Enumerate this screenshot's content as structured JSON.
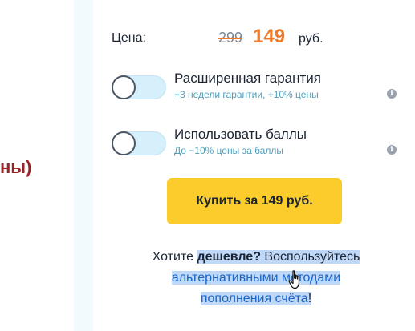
{
  "left_fragment": {
    "text": "ны)"
  },
  "price": {
    "label": "Цена:",
    "old_price": "299",
    "new_price": "149",
    "currency": "руб."
  },
  "options": [
    {
      "title": "Расширенная гарантия",
      "subtitle": "+3 недели гарантии, +10% цены",
      "enabled": false,
      "info_icon": "info-icon"
    },
    {
      "title": "Использовать баллы",
      "subtitle": "До −10% цены за баллы",
      "enabled": false,
      "info_icon": "info-icon"
    }
  ],
  "buy_button": {
    "label": "Купить за 149 руб."
  },
  "hint": {
    "prefix": "Хотите ",
    "bold_word": "дешевле?",
    "after_bold": " Воспользуйтесь",
    "link_line1": "альтернативными методами",
    "link_line2": "пополнения счёта",
    "suffix": "!"
  },
  "colors": {
    "accent_orange": "#f07b2a",
    "button_yellow": "#fccb2c",
    "link_blue": "#1a66c9",
    "toggle_off": "#d5effb",
    "selection": "#bfd8f7"
  },
  "cursor": {
    "icon": "hand-pointer-icon"
  }
}
